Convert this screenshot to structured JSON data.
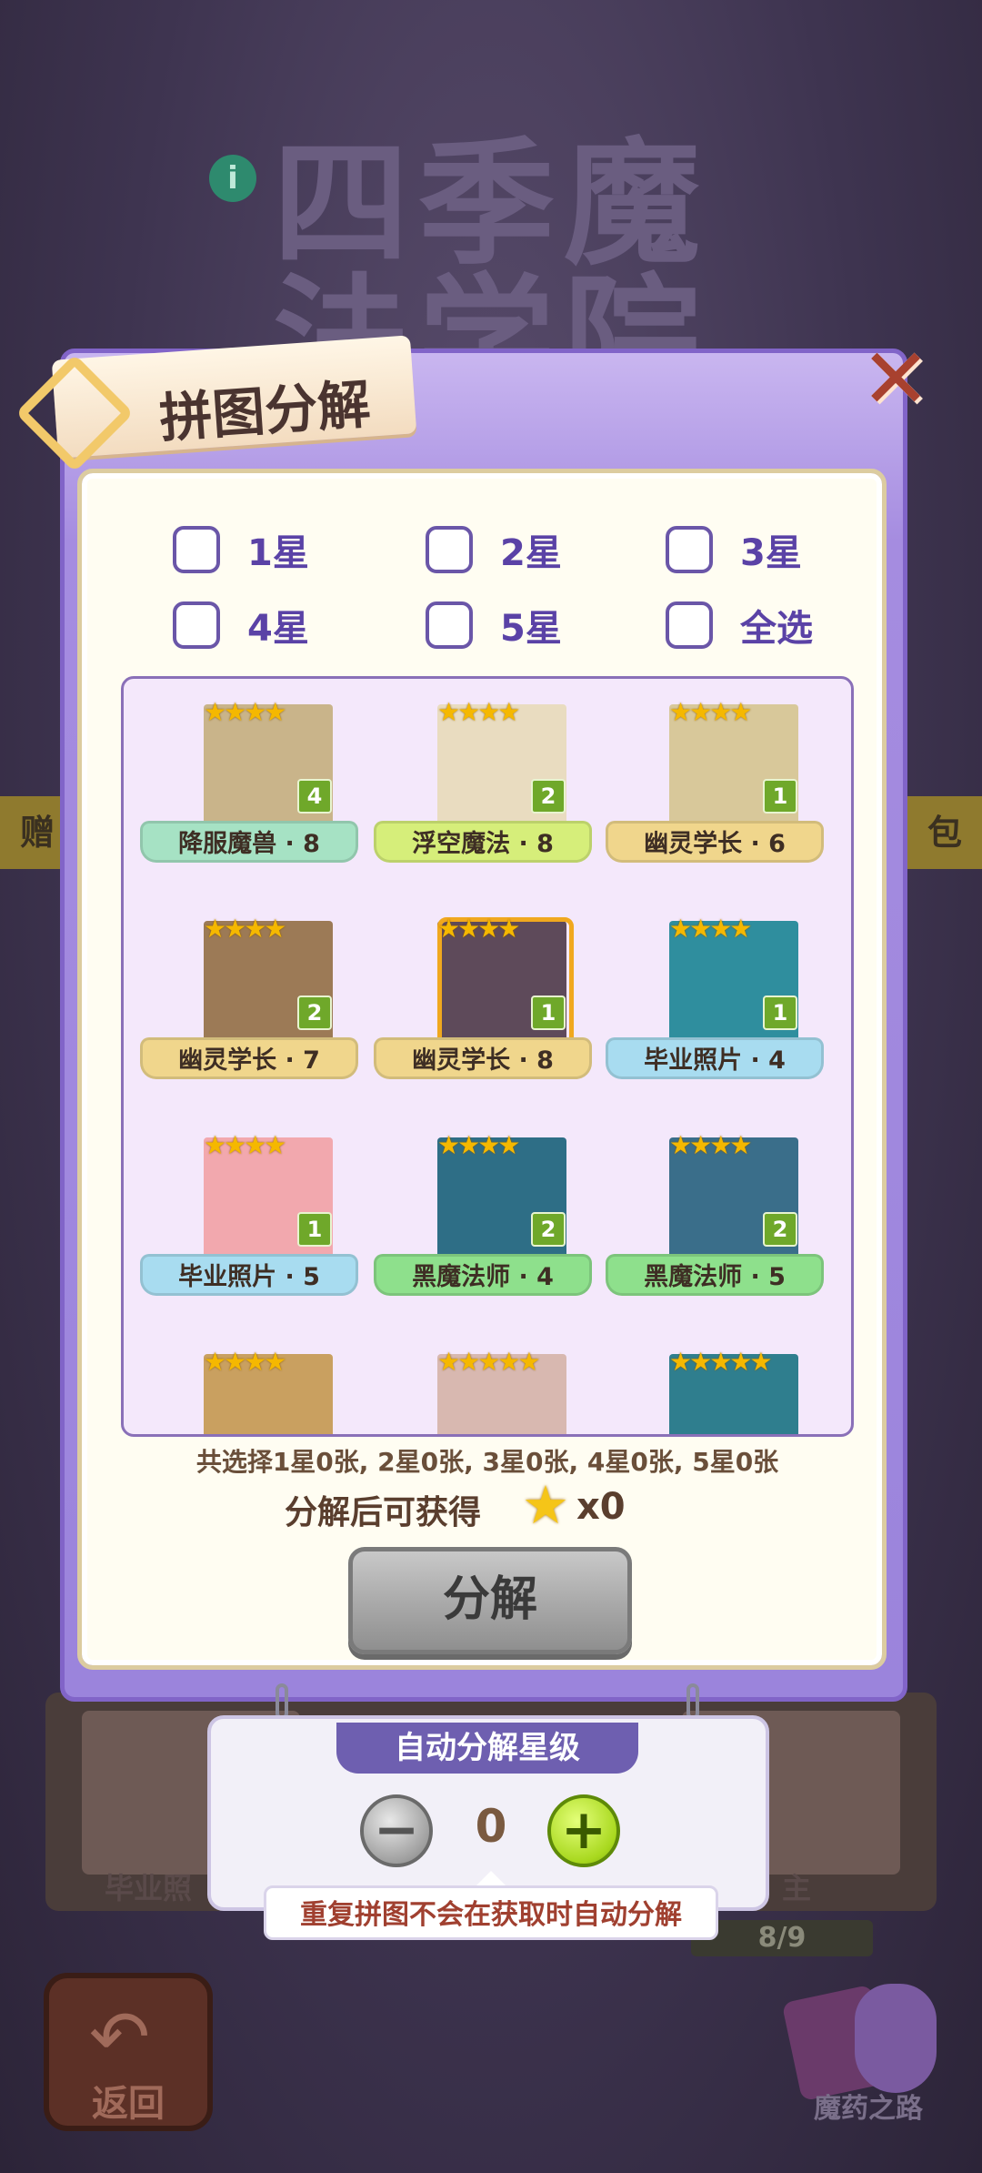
{
  "background": {
    "title": "四季魔法学院",
    "info_icon": "i",
    "strip_left": "赠",
    "strip_right": "包",
    "bottom_label_left": "毕业照",
    "bottom_label_right": "主",
    "progress": "8/9",
    "back_label": "返回",
    "potion_label": "魔药之路"
  },
  "dialog": {
    "title": "拼图分解",
    "close_icon": "close-x"
  },
  "filters": [
    {
      "label": "1星"
    },
    {
      "label": "2星"
    },
    {
      "label": "3星"
    },
    {
      "label": "4星"
    },
    {
      "label": "5星"
    },
    {
      "label": "全选"
    }
  ],
  "cards": [
    {
      "stars": "★★★★",
      "count": "4",
      "label": "降服魔兽 · 8",
      "ribbon_color": "#a6e2c4",
      "image_color": "#c9b48a"
    },
    {
      "stars": "★★★★",
      "count": "2",
      "label": "浮空魔法 · 8",
      "ribbon_color": "#d6ee7a",
      "image_color": "#e9dcc0"
    },
    {
      "stars": "★★★★",
      "count": "1",
      "label": "幽灵学长 · 6",
      "ribbon_color": "#f0d68c",
      "image_color": "#d8c89a"
    },
    {
      "stars": "★★★★",
      "count": "2",
      "label": "幽灵学长 · 7",
      "ribbon_color": "#f0d68c",
      "image_color": "#9c7a56"
    },
    {
      "stars": "★★★★",
      "count": "1",
      "label": "幽灵学长 · 8",
      "ribbon_color": "#f0d68c",
      "image_color": "#5e4a5a"
    },
    {
      "stars": "★★★★",
      "count": "1",
      "label": "毕业照片 · 4",
      "ribbon_color": "#a8dcf0",
      "image_color": "#2f8e9e"
    },
    {
      "stars": "★★★★",
      "count": "1",
      "label": "毕业照片 · 5",
      "ribbon_color": "#a8dcf0",
      "image_color": "#f2a8ae"
    },
    {
      "stars": "★★★★",
      "count": "2",
      "label": "黑魔法师 · 4",
      "ribbon_color": "#8ee08c",
      "image_color": "#2e6e86"
    },
    {
      "stars": "★★★★",
      "count": "2",
      "label": "黑魔法师 · 5",
      "ribbon_color": "#8ee08c",
      "image_color": "#3a6e8a"
    },
    {
      "stars": "★★★★",
      "count": "",
      "label": "",
      "ribbon_color": "",
      "image_color": "#c9a060"
    },
    {
      "stars": "★★★★★",
      "count": "",
      "label": "",
      "ribbon_color": "",
      "image_color": "#d8b8b0"
    },
    {
      "stars": "★★★★★",
      "count": "",
      "label": "",
      "ribbon_color": "",
      "image_color": "#2f7e8e"
    }
  ],
  "summary": "共选择1星0张, 2星0张, 3星0张, 4星0张, 5星0张",
  "gain": {
    "label": "分解后可获得",
    "icon": "star-icon",
    "amount": "x0"
  },
  "decompose_button": "分解",
  "auto": {
    "title": "自动分解星级",
    "value": "0",
    "note": "重复拼图不会在获取时自动分解"
  }
}
